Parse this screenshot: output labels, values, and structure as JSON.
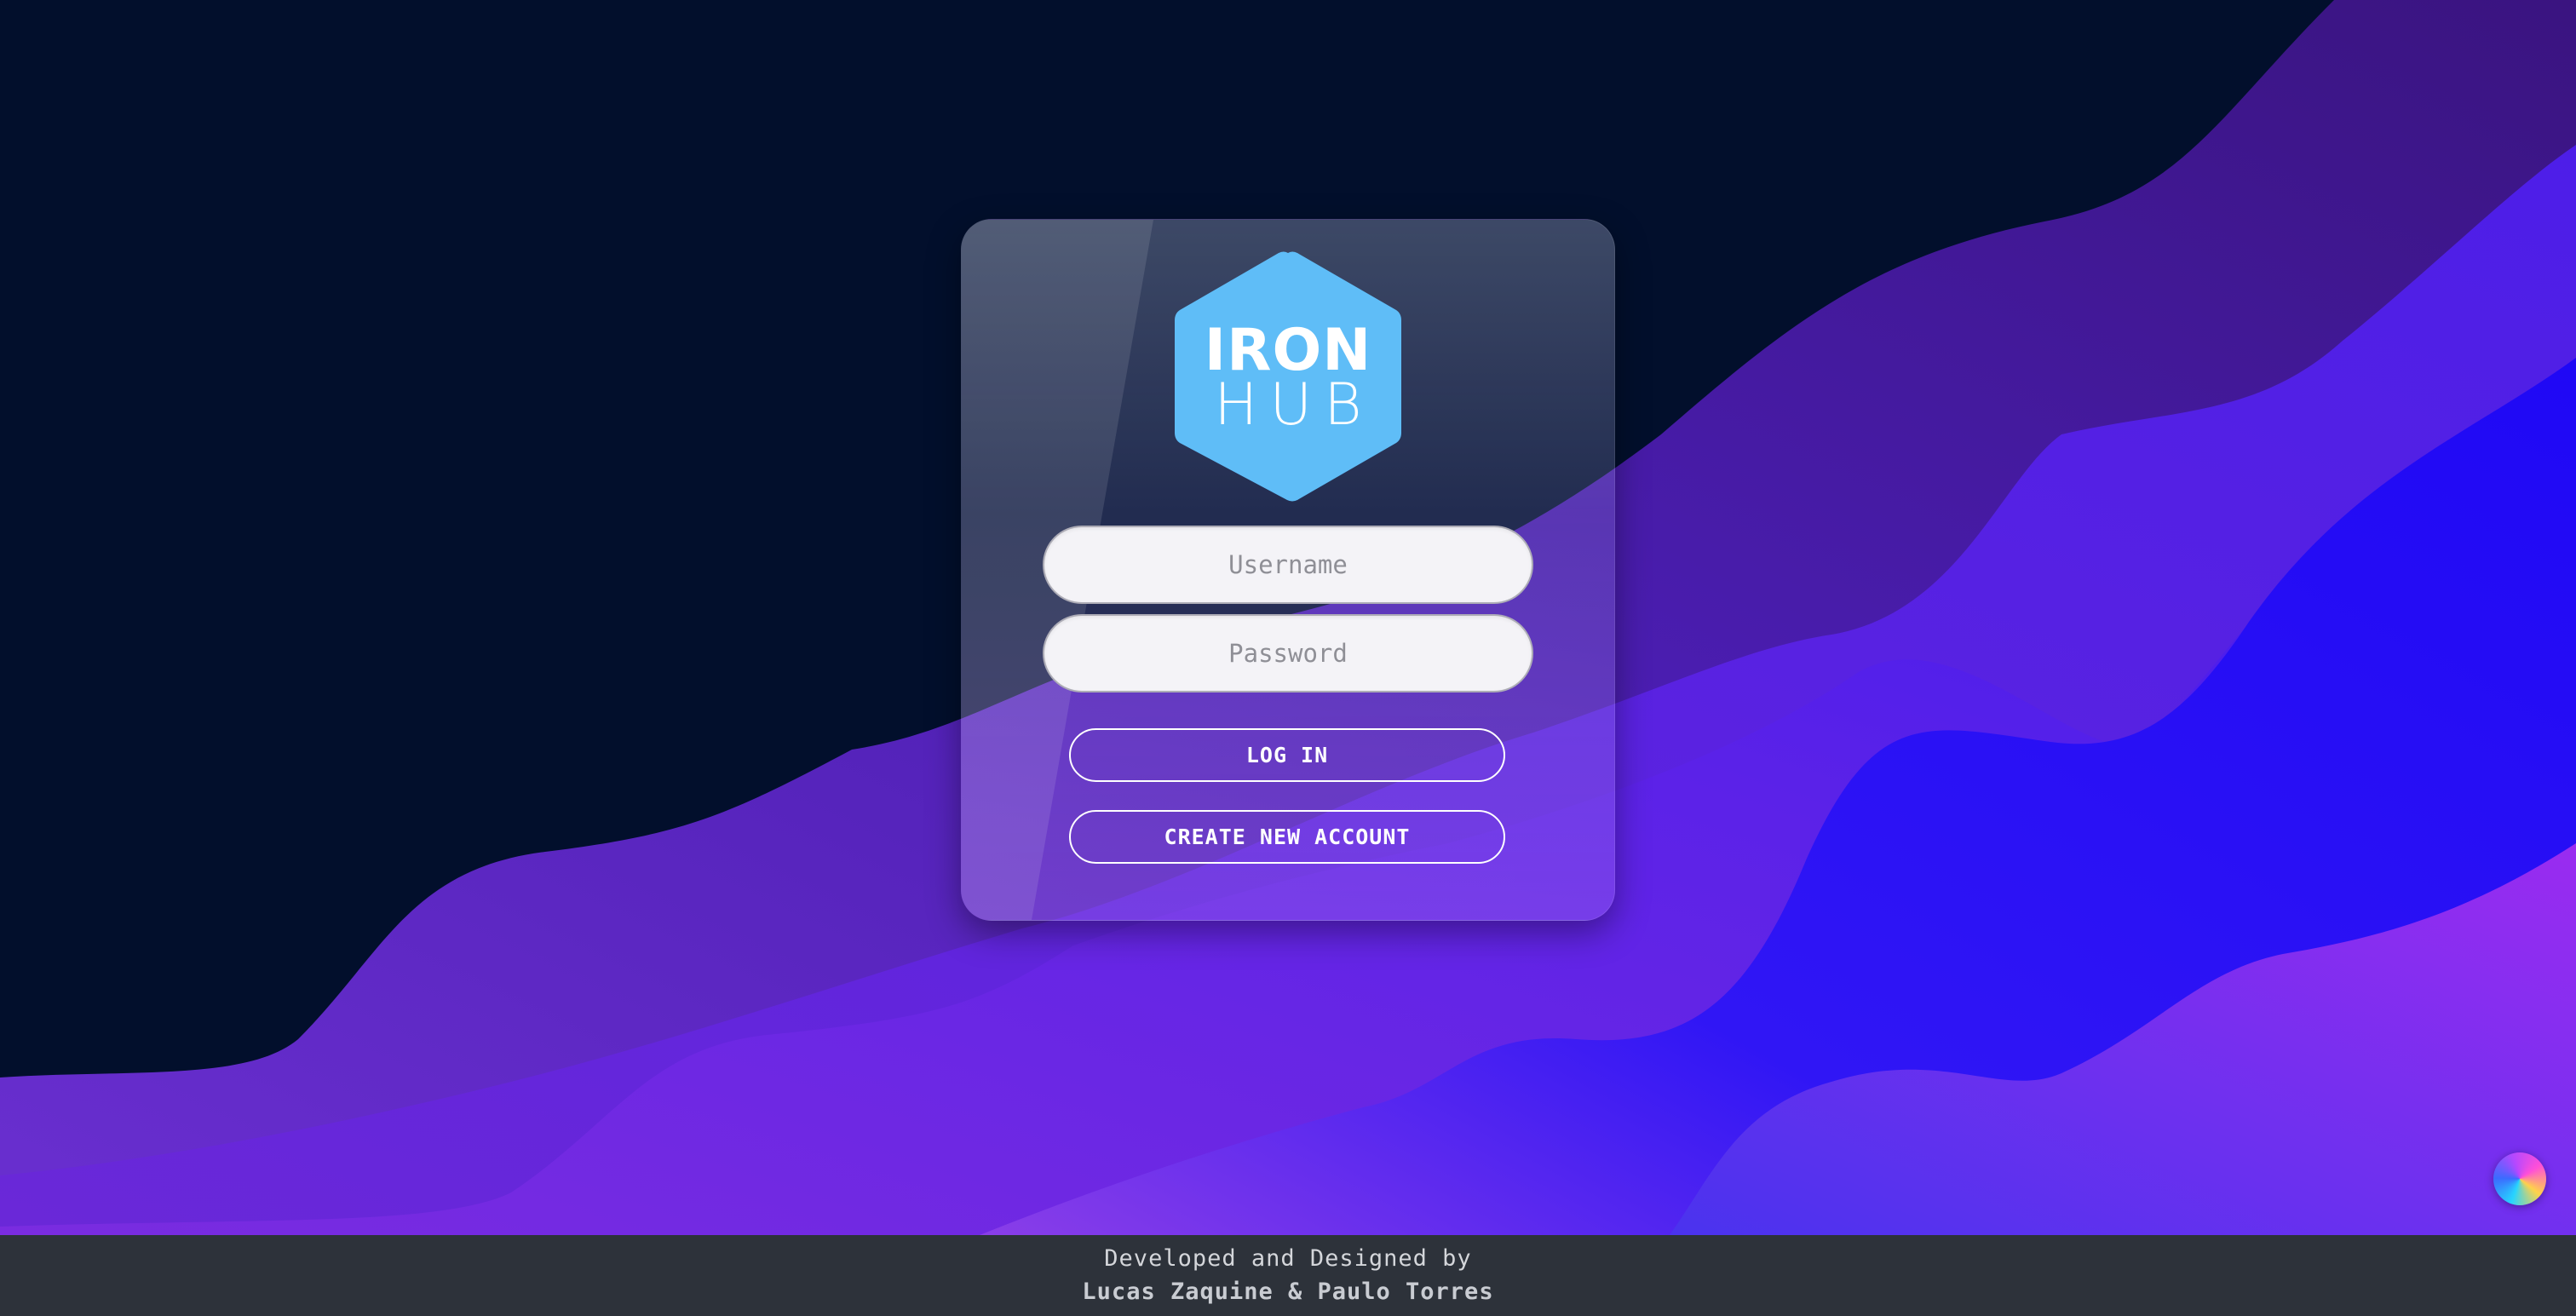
{
  "logo": {
    "line1": "IRON",
    "line2": "HUB",
    "color": "#5fbdf7"
  },
  "form": {
    "username_placeholder": "Username",
    "password_placeholder": "Password",
    "login_label": "LOG IN",
    "create_label": "CREATE NEW ACCOUNT"
  },
  "footer": {
    "line1": "Developed and Designed by",
    "line2": "Lucas Zaquine & Paulo Torres",
    "background": "#2d323a"
  },
  "theme": {
    "background": "#020f2c",
    "wave_colors": [
      "#3b1480",
      "#4c1dd8",
      "#6d28e0",
      "#2a08f0",
      "#8a2ef0"
    ]
  },
  "widgets": {
    "floating_button_icon": "gradient-orb-icon"
  }
}
